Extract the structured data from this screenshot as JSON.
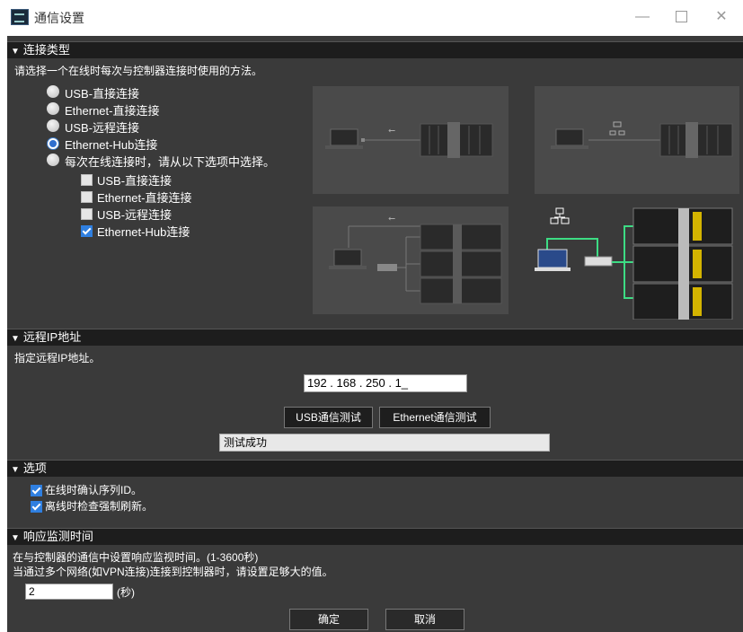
{
  "window": {
    "title": "通信设置"
  },
  "sections": {
    "conn_type": {
      "header": "连接类型",
      "description": "请选择一个在线时每次与控制器连接时使用的方法。",
      "radios": [
        {
          "label": "USB-直接连接",
          "selected": false
        },
        {
          "label": "Ethernet-直接连接",
          "selected": false
        },
        {
          "label": "USB-远程连接",
          "selected": false
        },
        {
          "label": "Ethernet-Hub连接",
          "selected": true
        },
        {
          "label": "每次在线连接时，请从以下选项中选择。",
          "selected": false
        }
      ],
      "sub_checks": [
        {
          "label": "USB-直接连接",
          "checked": false
        },
        {
          "label": "Ethernet-直接连接",
          "checked": false
        },
        {
          "label": "USB-远程连接",
          "checked": false
        },
        {
          "label": "Ethernet-Hub连接",
          "checked": true
        }
      ]
    },
    "remote_ip": {
      "header": "远程IP地址",
      "description": "指定远程IP地址。",
      "ip_value": "192 . 168 . 250 . 1_",
      "usb_test": "USB通信测试",
      "eth_test": "Ethernet通信测试",
      "result": "测试成功"
    },
    "options": {
      "header": "选项",
      "items": [
        {
          "label": "在线时确认序列ID。",
          "checked": true
        },
        {
          "label": "离线时检查强制刷新。",
          "checked": true
        }
      ]
    },
    "response": {
      "header": "响应监测时间",
      "line1": "在与控制器的通信中设置响应监视时间。(1-3600秒)",
      "line2": "当通过多个网络(如VPN连接)连接到控制器时，请设置足够大的值。",
      "value": "2",
      "unit": "(秒)"
    }
  },
  "footer": {
    "ok": "确定",
    "cancel": "取消"
  },
  "colors": {
    "accent_green": "#3ddc84",
    "selection_blue": "#2f6fcf"
  }
}
